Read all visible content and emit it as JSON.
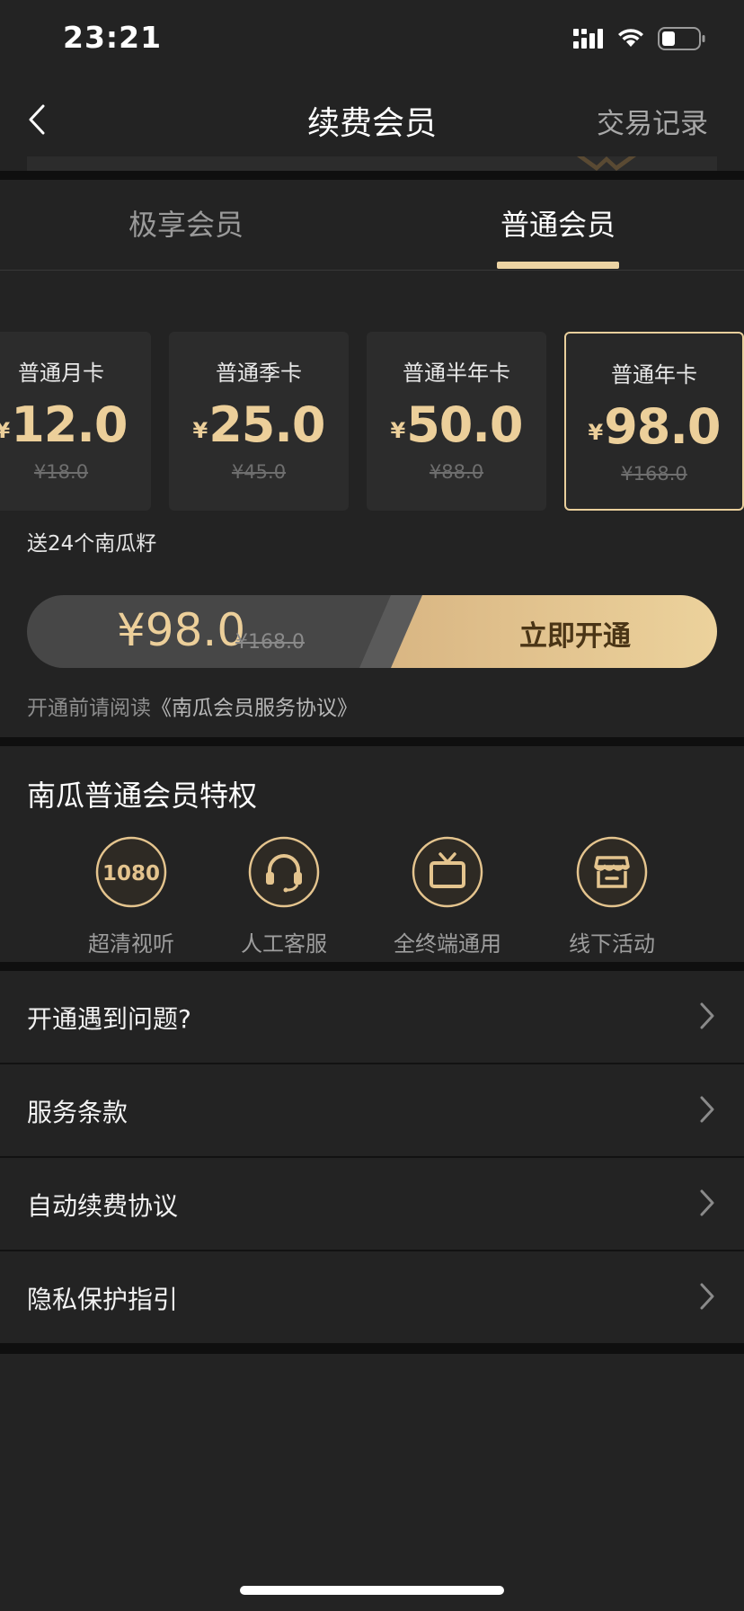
{
  "status_bar": {
    "time": "23:21"
  },
  "nav": {
    "title": "续费会员",
    "right_action": "交易记录"
  },
  "tabs": [
    {
      "label": "极享会员",
      "active": false
    },
    {
      "label": "普通会员",
      "active": true
    }
  ],
  "plans": [
    {
      "name": "普通月卡",
      "currency": "¥",
      "price": "12.0",
      "original": "¥18.0",
      "selected": false
    },
    {
      "name": "普通季卡",
      "currency": "¥",
      "price": "25.0",
      "original": "¥45.0",
      "selected": false
    },
    {
      "name": "普通半年卡",
      "currency": "¥",
      "price": "50.0",
      "original": "¥88.0",
      "selected": false
    },
    {
      "name": "普通年卡",
      "currency": "¥",
      "price": "98.0",
      "original": "¥168.0",
      "selected": true
    }
  ],
  "plan_bonus": "送24个南瓜籽",
  "buy_bar": {
    "price": "¥98.0",
    "original": "¥168.0",
    "button_label": "立即开通"
  },
  "agreement": {
    "prefix": "开通前请阅读",
    "link": "《南瓜会员服务协议》"
  },
  "privileges": {
    "title": "南瓜普通会员特权",
    "items": [
      {
        "label": "超清视听",
        "icon": "hd-1080-icon",
        "badge": "1080"
      },
      {
        "label": "人工客服",
        "icon": "headset-icon"
      },
      {
        "label": "全终端通用",
        "icon": "tv-icon"
      },
      {
        "label": "线下活动",
        "icon": "store-icon"
      }
    ]
  },
  "menu": [
    {
      "label": "开通遇到问题?"
    },
    {
      "label": "服务条款"
    },
    {
      "label": "自动续费协议"
    },
    {
      "label": "隐私保护指引"
    }
  ],
  "colors": {
    "accent_gold": "#eccf9a",
    "background": "#232323",
    "card": "#2c2c2c"
  }
}
